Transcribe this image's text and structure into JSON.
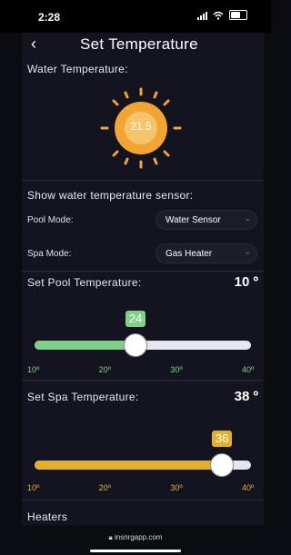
{
  "status": {
    "time": "2:28"
  },
  "header": {
    "back_icon": "chevron-left-icon",
    "title": "Set Temperature"
  },
  "water": {
    "label": "Water Temperature:",
    "value": "21.5",
    "sun_color": "#f2a532"
  },
  "sensor": {
    "heading": "Show water temperature sensor:",
    "pool_label": "Pool Mode:",
    "pool_value": "Water Sensor",
    "spa_label": "Spa Mode:",
    "spa_value": "Gas Heater"
  },
  "pool": {
    "label": "Set Pool Temperature:",
    "value": "10 º",
    "slider_value": "24",
    "slider_level": 24,
    "min": 10,
    "max": 40,
    "ticks": [
      "10º",
      "20º",
      "30º",
      "40º"
    ],
    "color": "#7fd18a"
  },
  "spa": {
    "label": "Set Spa Temperature:",
    "value": "38 º",
    "slider_value": "36",
    "slider_level": 36,
    "min": 10,
    "max": 40,
    "ticks": [
      "10º",
      "20º",
      "30º",
      "40º"
    ],
    "color": "#e2b12c"
  },
  "heaters": {
    "label": "Heaters"
  },
  "browser": {
    "url": "insnrgapp.com"
  }
}
